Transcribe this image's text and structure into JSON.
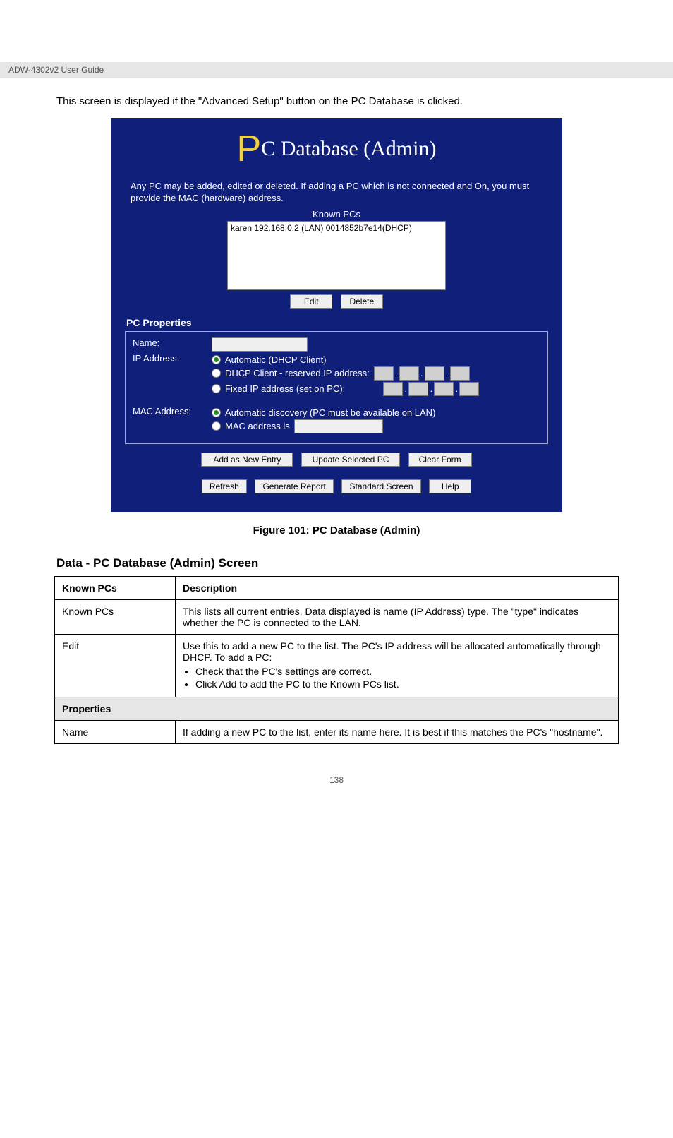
{
  "doc": {
    "header_left": "ADW-4302v2 User Guide",
    "intro": "This screen is displayed if the \"Advanced Setup\" button on the PC Database is clicked.",
    "figure_caption": "Figure 101: PC Database (Admin)",
    "data_heading": "Data - PC Database (Admin) Screen",
    "page_number": "138"
  },
  "panel": {
    "title_rest": "C Database (Admin)",
    "description": "Any PC may be added, edited or deleted. If adding a PC which is not connected and On, you must provide the MAC (hardware) address.",
    "known_label": "Known PCs",
    "known_entry": "karen 192.168.0.2 (LAN) 0014852b7e14(DHCP)",
    "btn_edit": "Edit",
    "btn_delete": "Delete",
    "section_props": "PC Properties",
    "lbl_name": "Name:",
    "lbl_ip": "IP Address:",
    "opt_auto": "Automatic (DHCP Client)",
    "opt_dhcp_reserved": "DHCP Client - reserved IP address:",
    "opt_fixed": "Fixed IP address (set on PC):",
    "lbl_mac": "MAC Address:",
    "opt_mac_auto": "Automatic discovery (PC must be available on LAN)",
    "opt_mac_is": "MAC address is",
    "btn_add": "Add as New Entry",
    "btn_update": "Update Selected PC",
    "btn_clear": "Clear Form",
    "btn_refresh": "Refresh",
    "btn_report": "Generate Report",
    "btn_standard": "Standard Screen",
    "btn_help": "Help"
  },
  "table": {
    "h1": "Known PCs",
    "h2": "Description",
    "r1c1": "Known PCs",
    "r1c2": "This lists all current entries. Data displayed is name (IP Address) type. The \"type\" indicates whether the PC is connected to the LAN.",
    "r2c1": "Edit",
    "r2c2_intro": "Use this to add a new PC to the list. The PC's IP address will be allocated automatically through DHCP. To add a PC:",
    "r2c2_b1": "Check that the PC's settings are correct.",
    "r2c2_b2": "Click Add to add the PC to the Known PCs list.",
    "section": "Properties",
    "r3c1": "Name",
    "r3c2": "If adding a new PC to the list, enter its name here. It is best if this matches the PC's \"hostname\"."
  }
}
